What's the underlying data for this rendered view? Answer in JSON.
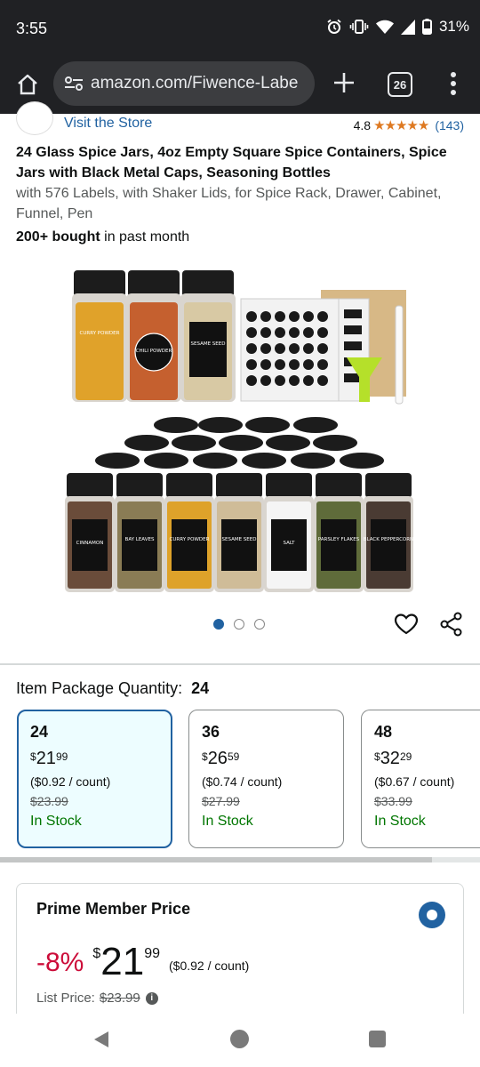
{
  "status_bar": {
    "time": "3:55",
    "battery": "31%",
    "icons": [
      "alarm-icon",
      "vibrate-icon",
      "wifi-icon",
      "signal-icon",
      "battery-icon"
    ]
  },
  "browser": {
    "url": "amazon.com/Fiwence-Labe",
    "tab_count": "26",
    "icons": [
      "home-icon",
      "site-settings-icon",
      "plus-icon",
      "tabs-icon",
      "more-vert-icon"
    ]
  },
  "store": {
    "link_text": "Visit the Store",
    "rating": "4.8",
    "stars": "★★★★★",
    "review_count": "(143)"
  },
  "product": {
    "title": "24 Glass Spice Jars, 4oz Empty Square Spice Containers, Spice Jars with Black Metal Caps, Seasoning Bottles",
    "subtitle": "with 576 Labels, with Shaker Lids, for Spice Rack, Drawer, Cabinet, Funnel, Pen",
    "bought_strong": "200+ bought",
    "bought_rest": " in past month",
    "image_labels": {
      "curry": "CURRY POWDER",
      "chili": "CHILI POWDER",
      "sesame": "SESAME SEED",
      "cinnamon": "CINNAMON",
      "bay": "BAY LEAVES",
      "curry2": "CURRY POWDER",
      "sesame2": "SESAME SEED",
      "salt": "SALT",
      "parsley": "PARSLEY FLAKES",
      "pepper": "BLACK PEPPERCORN"
    }
  },
  "carousel": {
    "dot_count": 3,
    "active_index": 0
  },
  "quantity": {
    "label": "Item Package Quantity:",
    "selected": "24",
    "options": [
      {
        "qty": "24",
        "symbol": "$",
        "whole": "21",
        "cents": "99",
        "unit": "($0.92 / count)",
        "list": "$23.99",
        "stock": "In Stock"
      },
      {
        "qty": "36",
        "symbol": "$",
        "whole": "26",
        "cents": "59",
        "unit": "($0.74 / count)",
        "list": "$27.99",
        "stock": "In Stock"
      },
      {
        "qty": "48",
        "symbol": "$",
        "whole": "32",
        "cents": "29",
        "unit": "($0.67 / count)",
        "list": "$33.99",
        "stock": "In Stock"
      }
    ]
  },
  "prime": {
    "title": "Prime Member Price",
    "discount": "-8%",
    "symbol": "$",
    "whole": "21",
    "cents": "99",
    "unit": "($0.92 / count)",
    "list_label": "List Price:",
    "list_price": "$23.99",
    "info": "i"
  },
  "colors": {
    "link": "#2162a1",
    "star": "#de7921",
    "deal": "#cc0c39",
    "stock": "#007600",
    "selected_bg": "#edfdff"
  }
}
